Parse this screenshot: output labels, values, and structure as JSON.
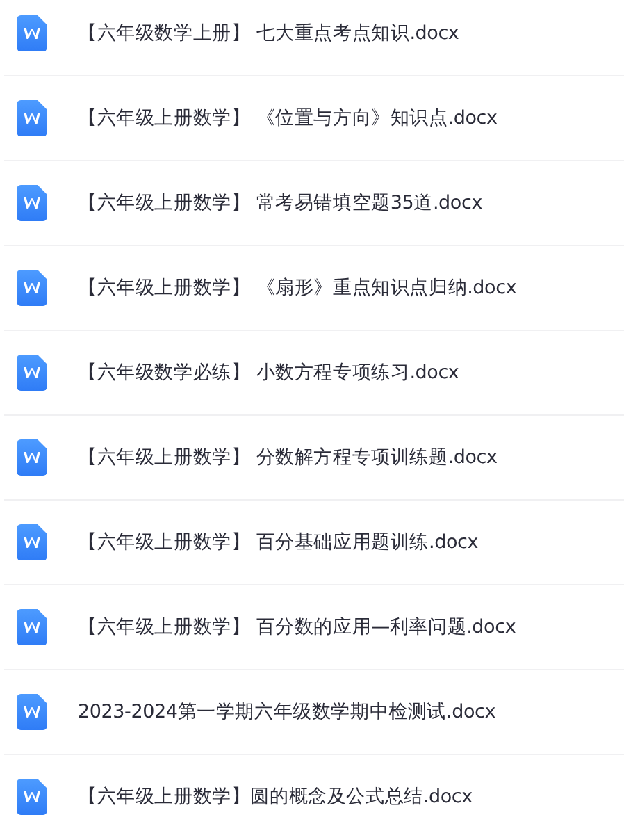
{
  "files": [
    {
      "name": "【六年级数学上册】 七大重点考点知识.docx"
    },
    {
      "name": "【六年级上册数学】 《位置与方向》知识点.docx"
    },
    {
      "name": "【六年级上册数学】 常考易错填空题35道.docx"
    },
    {
      "name": "【六年级上册数学】 《扇形》重点知识点归纳.docx"
    },
    {
      "name": "【六年级数学必练】 小数方程专项练习.docx"
    },
    {
      "name": "【六年级上册数学】 分数解方程专项训练题.docx"
    },
    {
      "name": "【六年级上册数学】 百分基础应用题训练.docx"
    },
    {
      "name": "【六年级上册数学】 百分数的应用—利率问题.docx"
    },
    {
      "name": "2023-2024第一学期六年级数学期中检测试.docx"
    },
    {
      "name": "【六年级上册数学】圆的概念及公式总结.docx"
    }
  ]
}
